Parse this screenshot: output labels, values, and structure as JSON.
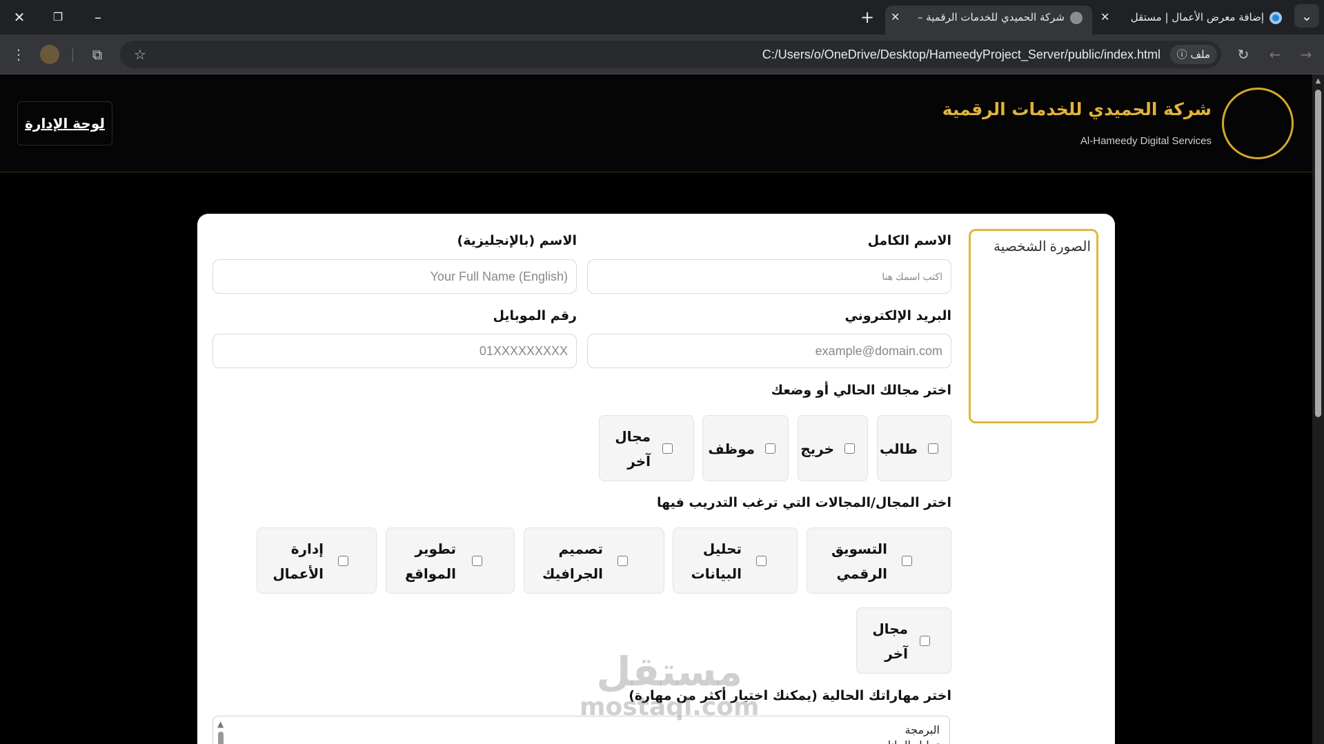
{
  "browser": {
    "tabs": [
      {
        "title": "إضافة معرض الأعمال | مستقل",
        "active": false
      },
      {
        "title": "شركة الحميدي للخدمات الرقمية –",
        "active": true
      }
    ],
    "new_tab_icon": "+",
    "tab_search_icon": "⌄",
    "url": "C:/Users/o/OneDrive/Desktop/HameedyProject_Server/public/index.html",
    "file_chip_label": "ملف"
  },
  "header": {
    "company_name_ar": "شركة الحميدي للخدمات الرقمية",
    "company_name_en": "Al-Hameedy Digital Services",
    "admin_label": "لوحة الإدارة"
  },
  "form": {
    "photo_alt": "الصورة الشخصية",
    "full_name": {
      "label": "الاسم الكامل",
      "placeholder": "اكتب اسمك هنا"
    },
    "name_en": {
      "label": "الاسم (بالإنجليزية)",
      "placeholder": "Your Full Name (English)"
    },
    "email": {
      "label": "البريد الإلكتروني",
      "placeholder": "example@domain.com"
    },
    "mobile": {
      "label": "رقم الموبايل",
      "placeholder": "01XXXXXXXXX"
    },
    "status": {
      "label": "اختر مجالك الحالي أو وضعك",
      "options": [
        "طالب",
        "خريج",
        "موظف",
        "مجال آخر"
      ]
    },
    "training": {
      "label": "اختر المجال/المجالات التي ترغب التدريب فيها",
      "options": [
        "التسويق الرقمي",
        "تحليل البيانات",
        "تصميم الجرافيك",
        "تطوير المواقع",
        "إدارة الأعمال",
        "مجال آخر"
      ]
    },
    "skills": {
      "label": "اختر مهاراتك الحالية (يمكنك اختيار أكثر من مهارة)",
      "items": [
        "البرمجة",
        "تحليل البيانات"
      ]
    }
  },
  "watermark": {
    "line1": "مستقل",
    "line2": "mostaql.com"
  }
}
